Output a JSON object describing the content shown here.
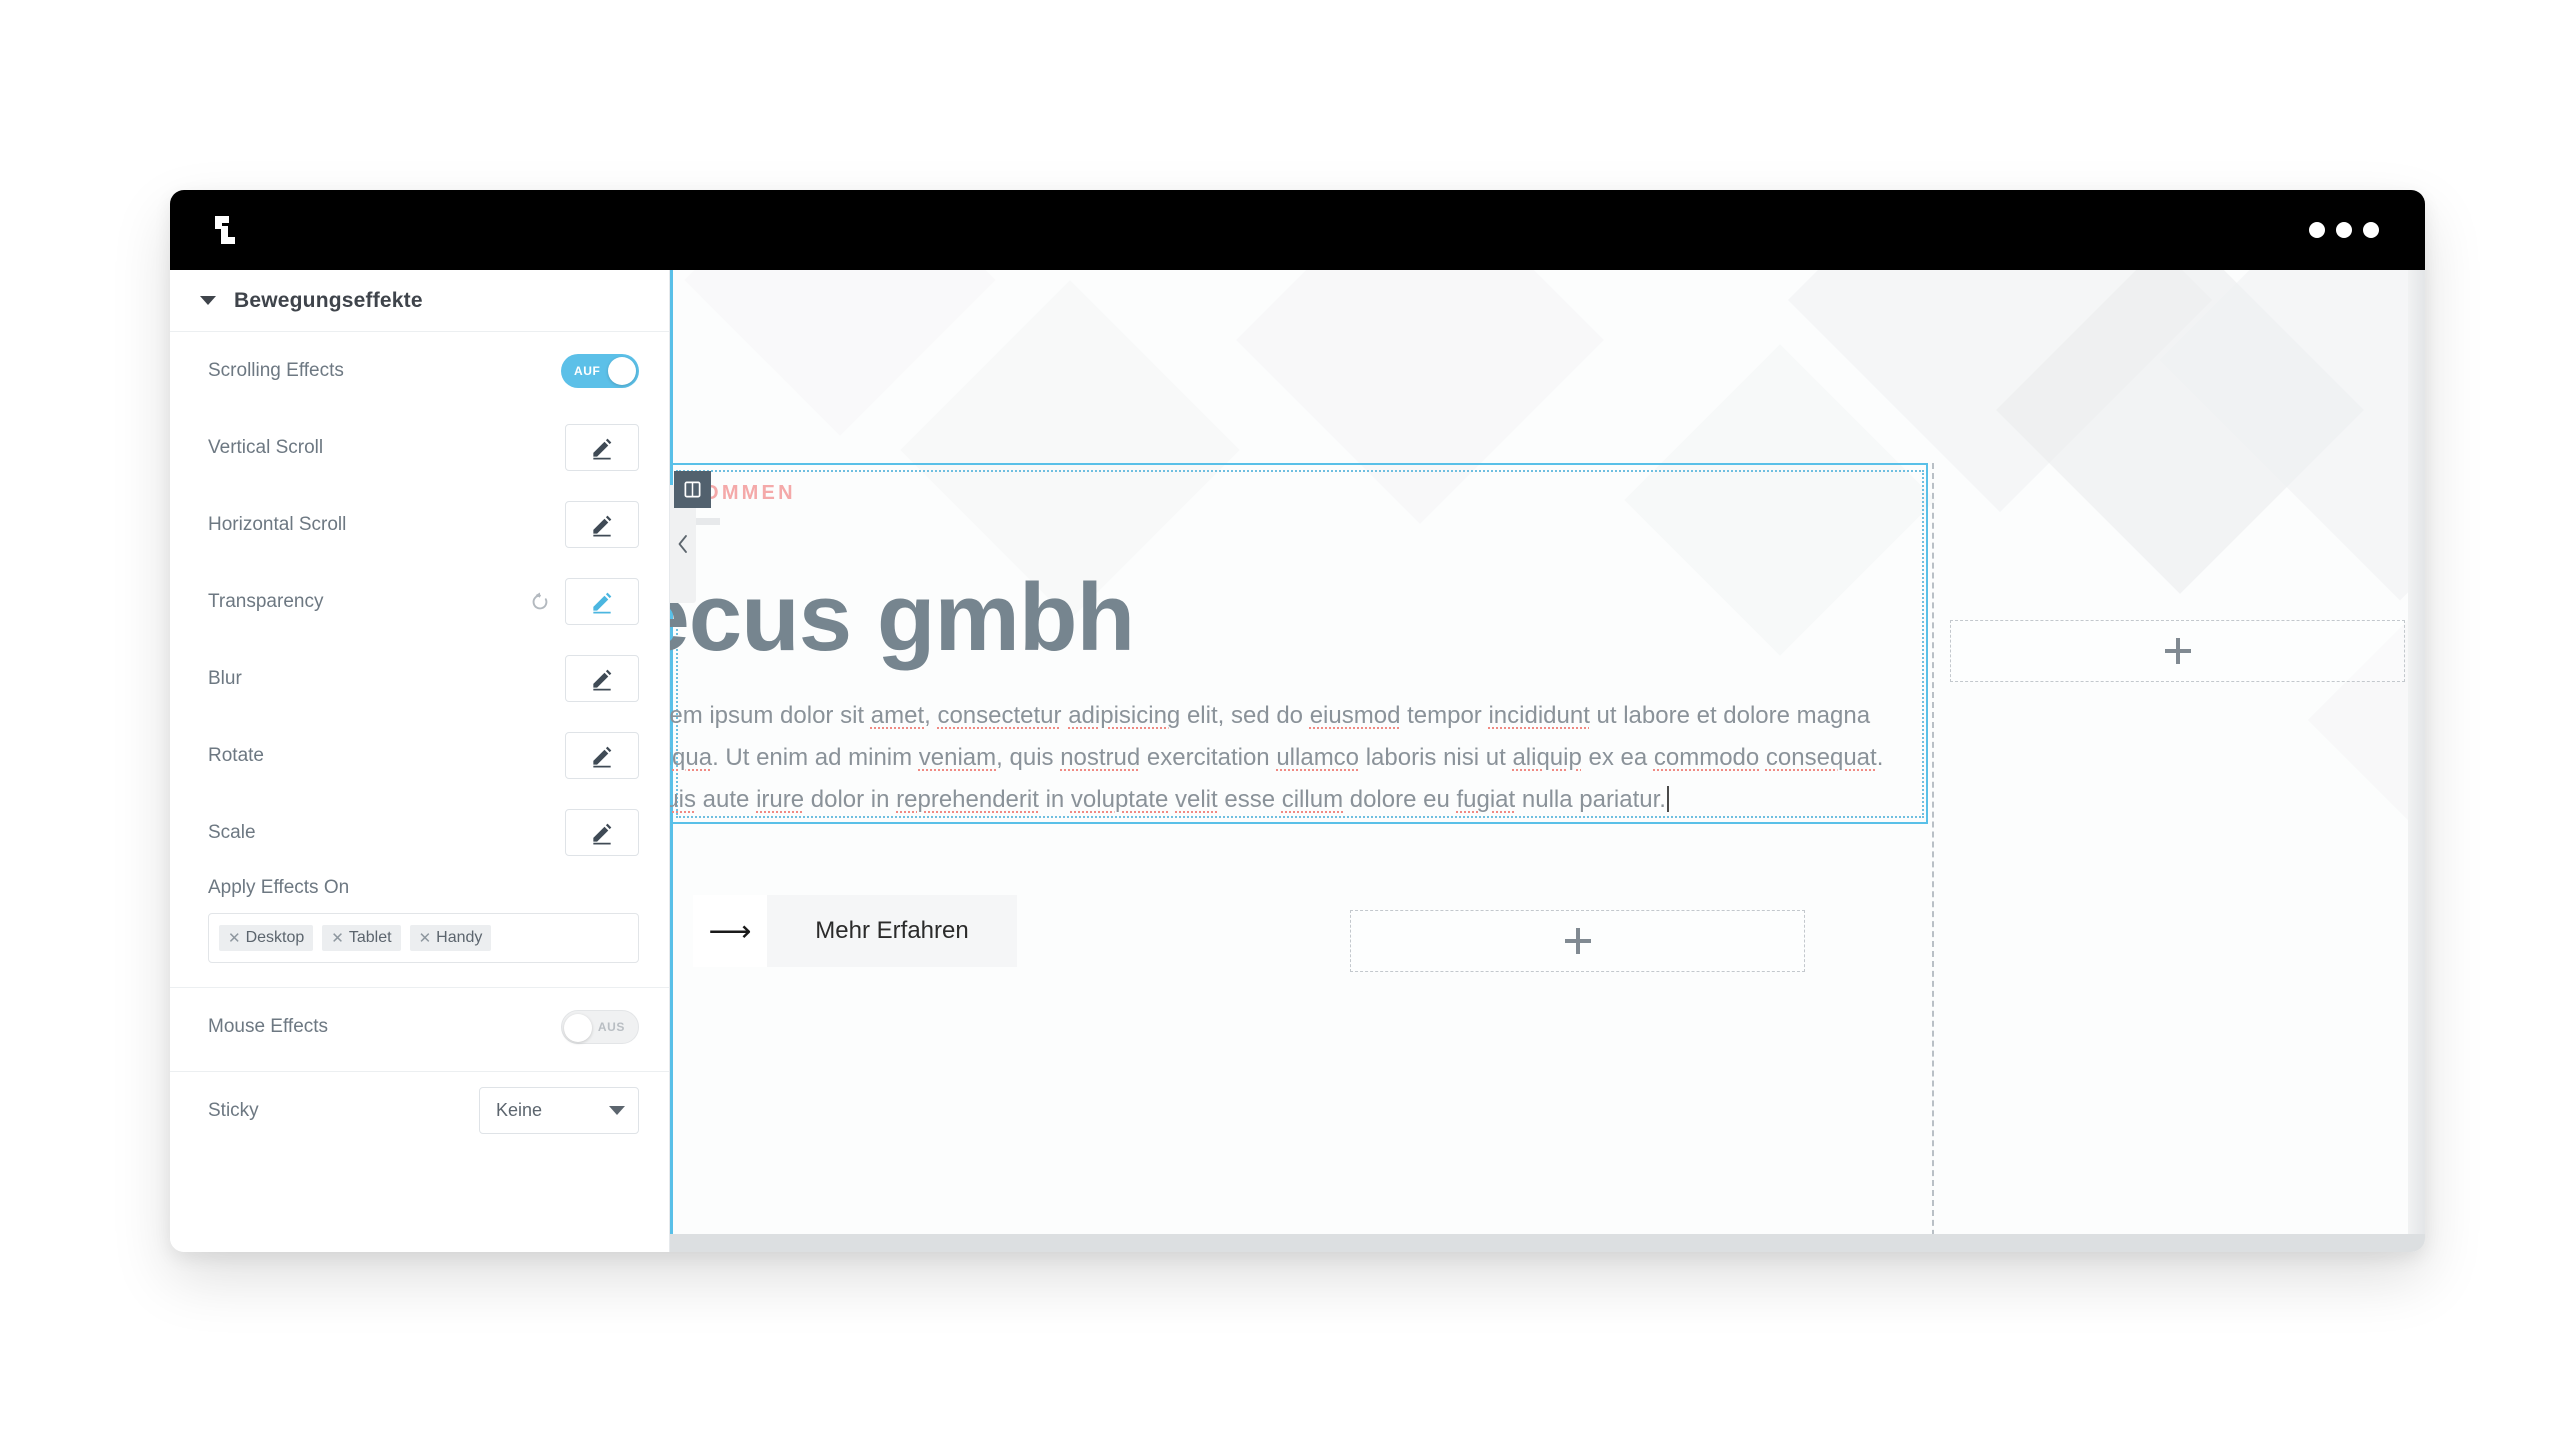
{
  "window": {
    "logo_icon": "elementor-z-logo",
    "menu_dots": [
      "dot",
      "dot",
      "dot"
    ]
  },
  "panel": {
    "section_title": "Bewegungseffekte",
    "collapse_icon": "caret-down-icon",
    "rows": [
      {
        "label": "Scrolling Effects",
        "control": "toggle",
        "toggle_state": "AUF",
        "on": true
      },
      {
        "label": "Vertical Scroll",
        "control": "edit",
        "active": false,
        "reset": false
      },
      {
        "label": "Horizontal Scroll",
        "control": "edit",
        "active": false,
        "reset": false
      },
      {
        "label": "Transparency",
        "control": "edit",
        "active": true,
        "reset": true
      },
      {
        "label": "Blur",
        "control": "edit",
        "active": false,
        "reset": false
      },
      {
        "label": "Rotate",
        "control": "edit",
        "active": false,
        "reset": false
      },
      {
        "label": "Scale",
        "control": "edit",
        "active": false,
        "reset": false
      }
    ],
    "apply_effects": {
      "label": "Apply Effects On",
      "tags": [
        "Desktop",
        "Tablet",
        "Handy"
      ],
      "remove_icon": "close-x-icon"
    },
    "mouse_effects": {
      "label": "Mouse Effects",
      "toggle_state": "AUS",
      "on": false
    },
    "sticky": {
      "label": "Sticky",
      "value": "Keine",
      "arrow_icon": "chevron-down-icon"
    },
    "edit_icon": "pencil-icon",
    "reset_icon": "reset-circular-arrow-icon"
  },
  "canvas": {
    "widget_handle_icon": "column-layout-icon",
    "collapse_icon": "chevron-left-icon",
    "eyebrow": "LKOMMEN",
    "headline": "recus gmbh",
    "paragraph": {
      "line1_a": "orem ipsum dolor sit ",
      "line1_sp1": "amet",
      "line1_b": ", ",
      "line1_sp2": "consectetur",
      "line1_c": " ",
      "line1_sp3": "adipisicing",
      "line1_d": " elit, sed do ",
      "line1_sp4": "eiusmod",
      "line1_e": " tempor ",
      "line2_sp1": "incididunt",
      "line2_a": " ut labore et dolore magna ",
      "line2_sp2": "aliqua",
      "line2_b": ". Ut enim ad minim ",
      "line2_sp3": "veniam",
      "line2_c": ", quis ",
      "line2_sp4": "nostrud",
      "line3_a": " exercitation ",
      "line3_sp1": "ullamco",
      "line3_b": " laboris nisi ut ",
      "line3_sp2": "aliquip",
      "line3_c": " ex ea ",
      "line3_sp3": "commodo",
      "line3_d": " ",
      "line3_sp4": "consequat",
      "line3_e": ". ",
      "line3_sp5": "Duis",
      "line3_f": " aute ",
      "line3_sp6": "irure",
      "line4_a": " dolor in ",
      "line4_sp1": "reprehenderit",
      "line4_b": " in ",
      "line4_sp2": "voluptate",
      "line4_c": " ",
      "line4_sp3": "velit",
      "line4_d": " esse ",
      "line4_sp4": "cillum",
      "line4_e": " dolore eu ",
      "line4_sp5": "fugiat",
      "line4_f": " nulla pariatur."
    },
    "cta": {
      "arrow_icon": "arrow-right-icon",
      "label": "Mehr Erfahren"
    },
    "placeholders": [
      {
        "name": "add-widget-right",
        "icon": "plus-icon"
      },
      {
        "name": "add-widget-bottom",
        "icon": "plus-icon"
      }
    ]
  },
  "colors": {
    "accent_blue": "#59c0e8",
    "titlebar": "#000000",
    "headline": "#76858f",
    "eyebrow_pink": "#f4a9a9",
    "spellcheck_red": "#f08a83",
    "panel_label": "#6d7882"
  }
}
